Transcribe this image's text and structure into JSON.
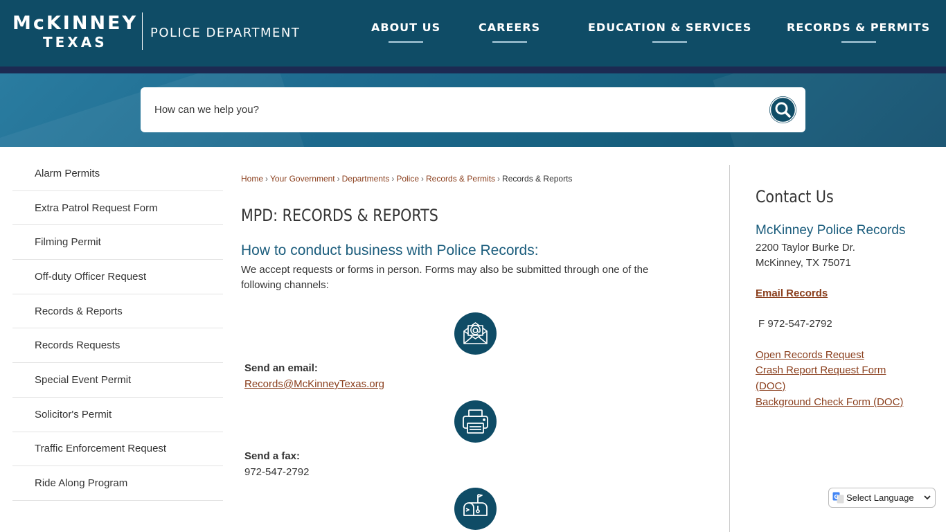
{
  "header": {
    "logo_city": "McKINNEY",
    "logo_state": "TEXAS",
    "logo_dept": "POLICE DEPARTMENT",
    "nav": [
      {
        "label": "ABOUT US"
      },
      {
        "label": "CAREERS"
      },
      {
        "label": "EDUCATION & SERVICES"
      },
      {
        "label": "RECORDS & PERMITS"
      }
    ]
  },
  "search": {
    "placeholder": "How can we help you?",
    "icon": "search-icon"
  },
  "sidebar": {
    "items": [
      {
        "label": "Alarm Permits"
      },
      {
        "label": "Extra Patrol Request Form"
      },
      {
        "label": "Filming Permit"
      },
      {
        "label": "Off-duty Officer Request"
      },
      {
        "label": "Records & Reports"
      },
      {
        "label": "Records Requests"
      },
      {
        "label": "Special Event Permit"
      },
      {
        "label": "Solicitor's Permit"
      },
      {
        "label": "Traffic Enforcement Request"
      },
      {
        "label": "Ride Along Program"
      }
    ]
  },
  "breadcrumb": {
    "items": [
      "Home",
      "Your Government",
      "Departments",
      "Police",
      "Records & Permits"
    ],
    "current": "Records & Reports",
    "separator": "›"
  },
  "main": {
    "title": "MPD: RECORDS & REPORTS",
    "subhead": "How to conduct business with Police Records:",
    "intro": "We accept requests or forms in person. Forms may also be submitted through one of the following channels:",
    "channels": [
      {
        "icon": "envelope-icon",
        "label": "Send an email:",
        "value": "Records@McKinneyTexas.org"
      },
      {
        "icon": "fax-icon",
        "label": "Send a fax:",
        "value": "972-547-2792"
      },
      {
        "icon": "mailbox-icon"
      }
    ]
  },
  "contact": {
    "title": "Contact Us",
    "name": "McKinney Police Records",
    "address1": "2200 Taylor Burke Dr.",
    "address2": "McKinney, TX 75071",
    "email_label": "Email Records",
    "fax": "F 972-547-2792",
    "links": [
      {
        "label": "Open Records Request"
      },
      {
        "label": "Crash Report Request Form"
      },
      {
        "label": "(DOC)"
      },
      {
        "label": "Background Check Form (DOC)"
      }
    ]
  },
  "translate": {
    "label": "Select Language"
  },
  "colors": {
    "header": "#0f4c66",
    "header_bar": "#1c2a52",
    "link": "#8a3e1c",
    "accent": "#1a5c7c"
  }
}
